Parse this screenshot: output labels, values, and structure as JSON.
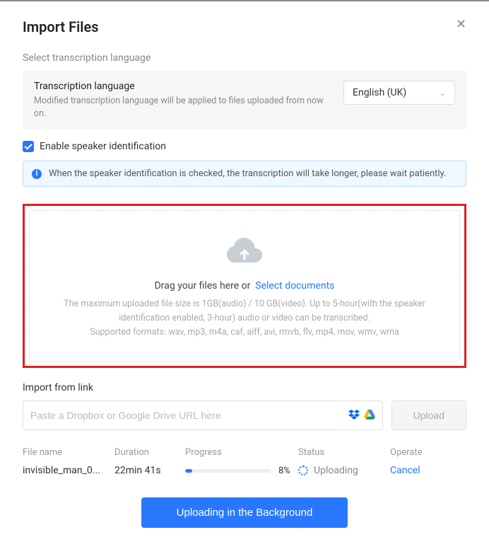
{
  "modal": {
    "title": "Import Files",
    "section_label": "Select transcription language"
  },
  "language": {
    "title": "Transcription language",
    "subtitle": "Modified transcription language will be applied to files uploaded from now on.",
    "selected": "English (UK)"
  },
  "speaker": {
    "checkbox_label": "Enable speaker identification",
    "checked": true,
    "info_text": "When the speaker identification is checked, the transcription will take longer, please wait patiently."
  },
  "dropzone": {
    "main_text": "Drag your files here or",
    "link_text": "Select documents",
    "help_line1": "The maximum uploaded file size is 1GB(audio) / 10 GB(video). Up to 5-hour(with the speaker identification enabled, 3-hour) audio or video can be transcribed.",
    "help_line2": "Supported formats: wav, mp3, m4a, caf, aiff, avi, rmvb, flv, mp4, mov, wmv, wma"
  },
  "import_link": {
    "label": "Import from link",
    "placeholder": "Paste a Dropbox or Google Drive URL here",
    "upload_button": "Upload"
  },
  "table": {
    "headers": {
      "filename": "File name",
      "duration": "Duration",
      "progress": "Progress",
      "status": "Status",
      "operate": "Operate"
    },
    "rows": [
      {
        "filename": "invisible_man_0...",
        "duration": "22min 41s",
        "progress_pct": "8%",
        "progress_val": 8,
        "status": "Uploading",
        "operate": "Cancel"
      }
    ]
  },
  "footer": {
    "background_button": "Uploading in the Background"
  }
}
